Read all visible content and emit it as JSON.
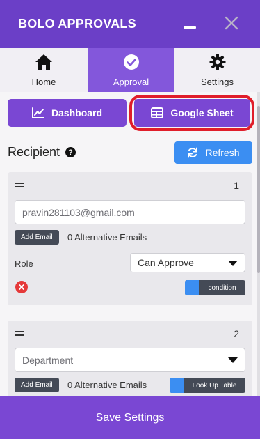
{
  "header": {
    "title": "BOLO APPROVALS",
    "minimize_icon": "minimize-icon",
    "close_icon": "close-icon"
  },
  "tabs": [
    {
      "label": "Home",
      "icon": "home-icon",
      "active": false
    },
    {
      "label": "Approval",
      "icon": "check-circle-icon",
      "active": true
    },
    {
      "label": "Settings",
      "icon": "gear-icon",
      "active": false
    }
  ],
  "actions": {
    "dashboard_label": "Dashboard",
    "google_sheet_label": "Google Sheet"
  },
  "recipient": {
    "title": "Recipient",
    "help_glyph": "?",
    "refresh_label": "Refresh"
  },
  "cards": [
    {
      "number": "1",
      "email_value": "pravin281103@gmail.com",
      "add_email_label": "Add Email",
      "alt_emails_text": "0 Alternative Emails",
      "role_label": "Role",
      "role_value": "Can Approve",
      "condition_label": "condition"
    },
    {
      "number": "2",
      "department_placeholder": "Department",
      "add_email_label": "Add Email",
      "alt_emails_text": "0 Alternative Emails",
      "lookup_label": "Look Up Table"
    }
  ],
  "footer": {
    "save_label": "Save Settings"
  },
  "colors": {
    "brand_purple": "#6b3fc7",
    "active_tab": "#8357db",
    "button_purple": "#7a47d3",
    "refresh_blue": "#3b8ef2",
    "highlight_red": "#e01e2a",
    "remove_red": "#e5393a"
  }
}
